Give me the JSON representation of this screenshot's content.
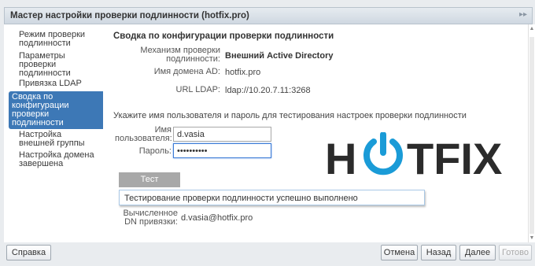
{
  "window": {
    "title": "Мастер настройки проверки подлинности (hotfix.pro)"
  },
  "sidebar": {
    "items": [
      {
        "label": "Режим проверки\nподлинности"
      },
      {
        "label": "Параметры\nпроверки\nподлинности"
      },
      {
        "label": "Привязка LDAP"
      },
      {
        "label": "Сводка по\nконфигурации\nпроверки\nподлинности",
        "active": true
      },
      {
        "label": "Настройка\nвнешней группы"
      },
      {
        "label": "Настройка домена\nзавершена"
      }
    ]
  },
  "main": {
    "heading": "Сводка по конфигурации проверки подлинности",
    "summary": {
      "mechanism_label": "Механизм проверки\nподлинности:",
      "mechanism_value": "Внешний Active Directory",
      "domain_label": "Имя домена AD:",
      "domain_value": "hotfix.pro",
      "url_label": "URL LDAP:",
      "url_value": "ldap://10.20.7.11:3268"
    },
    "prompt": "Укажите имя пользователя и пароль для тестирования настроек проверки подлинности",
    "username_label": "Имя\nпользователя:",
    "username_value": "d.vasia",
    "password_label": "Пароль:",
    "password_value": "••••••••••",
    "test_button": "Тест",
    "result_message": "Тестирование проверки подлинности успешно выполнено",
    "dn_label": "Вычисленное\nDN привязки:",
    "dn_value": "d.vasia@hotfix.pro"
  },
  "logo": {
    "text_left": "H",
    "text_right": "TFIX",
    "color": "#2b2b2b",
    "accent": "#1a9bd7"
  },
  "footer": {
    "help": "Справка",
    "cancel": "Отмена",
    "back": "Назад",
    "next": "Далее",
    "finish": "Готово"
  },
  "colors": {
    "accent": "#3d78b6",
    "focus": "#3b7bd6"
  }
}
